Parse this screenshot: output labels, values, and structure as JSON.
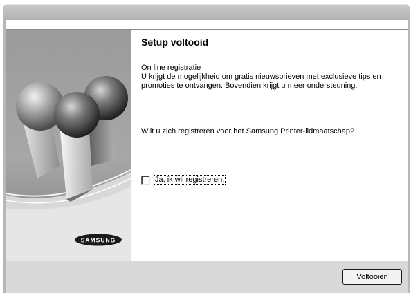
{
  "dialog": {
    "heading": "Setup voltooid",
    "paragraph1_line1": "On line registratie",
    "paragraph1_line2": "U krijgt de mogelijkheid om gratis nieuwsbrieven met exclusieve tips en",
    "paragraph1_line3": "promoties te ontvangen. Bovendien krijgt u meer ondersteuning.",
    "paragraph2": "Wilt u zich registreren voor het Samsung Printer-lidmaatschap?",
    "checkbox_label": "Ja, ik wil registreren.",
    "checkbox_checked": false
  },
  "side_panel": {
    "logo_text": "SAMSUNG"
  },
  "footer": {
    "finish_label": "Voltooien"
  },
  "colors": {
    "titlebar": "#bdbdbd",
    "footer": "#d9d9d9",
    "panel": "#8a8a8a"
  }
}
